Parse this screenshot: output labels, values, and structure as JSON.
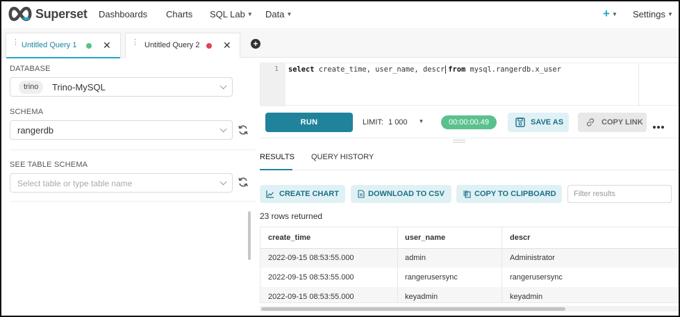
{
  "app": {
    "brand": "Superset"
  },
  "nav": {
    "items": [
      {
        "label": "Dashboards",
        "dropdown": false
      },
      {
        "label": "Charts",
        "dropdown": false
      },
      {
        "label": "SQL Lab",
        "dropdown": true
      },
      {
        "label": "Data",
        "dropdown": true
      }
    ],
    "plus_icon": "+",
    "settings": "Settings"
  },
  "query_tabs": [
    {
      "title": "Untitled Query 1",
      "status_color": "#5ac18e",
      "active": true
    },
    {
      "title": "Untitled Query 2",
      "status_color": "#e04355",
      "active": false
    }
  ],
  "left": {
    "database_label": "DATABASE",
    "database_tag": "trino",
    "database_value": "Trino-MySQL",
    "schema_label": "SCHEMA",
    "schema_value": "rangerdb",
    "table_schema_label": "SEE TABLE SCHEMA",
    "table_placeholder": "Select table or type table name"
  },
  "editor": {
    "line_number": "1",
    "kw_select": "select",
    "cols": " create_time, user_name, descr",
    "kw_from": "from",
    "table": " mysql.rangerdb.x_user"
  },
  "actions": {
    "run": "RUN",
    "limit_label": "LIMIT:",
    "limit_value": "1 000",
    "timer": "00:00:00.49",
    "save_as": "SAVE AS",
    "copy_link": "COPY LINK"
  },
  "results_tabs": {
    "results": "RESULTS",
    "history": "QUERY HISTORY"
  },
  "results": {
    "create_chart": "CREATE CHART",
    "download_csv": "DOWNLOAD TO CSV",
    "copy_clipboard": "COPY TO CLIPBOARD",
    "filter_placeholder": "Filter results",
    "row_count": "23 rows returned",
    "columns": [
      "create_time",
      "user_name",
      "descr"
    ],
    "rows": [
      [
        "2022-09-15 08:53:55.000",
        "admin",
        "Administrator"
      ],
      [
        "2022-09-15 08:53:55.000",
        "rangerusersync",
        "rangerusersync"
      ],
      [
        "2022-09-15 08:53:55.000",
        "keyadmin",
        "keyadmin"
      ]
    ]
  },
  "colors": {
    "accent": "#20a7c9",
    "run_button": "#20839b",
    "timer": "#5ac18e",
    "tab1_status": "#5ac18e",
    "tab2_status": "#e04355"
  },
  "icons": [
    "superset-logo-icon",
    "plus-icon",
    "grip-icon",
    "close-icon",
    "add-tab-icon",
    "chevron-down-icon",
    "refresh-icon",
    "save-icon",
    "link-icon",
    "more-icon",
    "chart-icon",
    "download-icon",
    "copy-icon"
  ]
}
